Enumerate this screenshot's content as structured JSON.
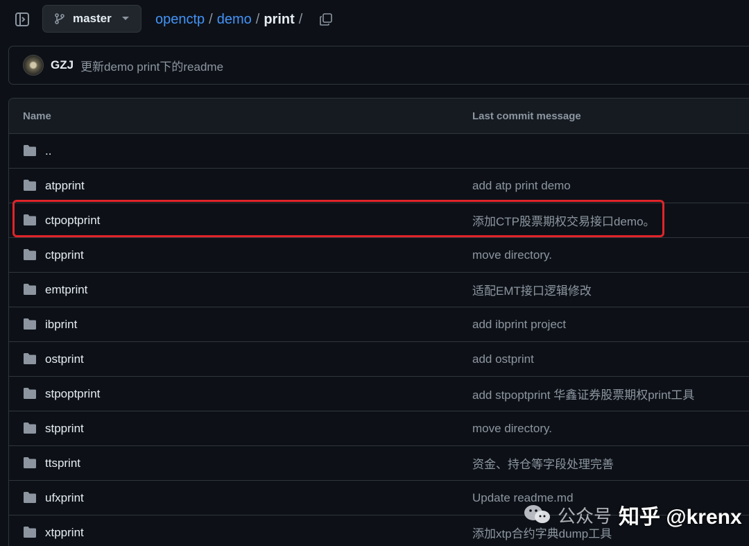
{
  "topbar": {
    "branch": "master",
    "breadcrumb": {
      "repo": "openctp",
      "sep1": "/",
      "dir1": "demo",
      "sep2": "/",
      "current": "print",
      "sep3": "/"
    }
  },
  "commit": {
    "author": "GZJ",
    "message": "更新demo print下的readme"
  },
  "table": {
    "headers": {
      "name": "Name",
      "message": "Last commit message"
    },
    "rows": [
      {
        "name": "..",
        "message": ""
      },
      {
        "name": "atpprint",
        "message": "add atp print demo"
      },
      {
        "name": "ctpoptprint",
        "message": "添加CTP股票期权交易接口demo。"
      },
      {
        "name": "ctpprint",
        "message": "move directory."
      },
      {
        "name": "emtprint",
        "message": "适配EMT接口逻辑修改"
      },
      {
        "name": "ibprint",
        "message": "add ibprint project"
      },
      {
        "name": "ostprint",
        "message": "add ostprint"
      },
      {
        "name": "stpoptprint",
        "message": "add stpoptprint 华鑫证券股票期权print工具"
      },
      {
        "name": "stpprint",
        "message": "move directory."
      },
      {
        "name": "ttsprint",
        "message": "资金、持仓等字段处理完善"
      },
      {
        "name": "ufxprint",
        "message": "Update readme.md"
      },
      {
        "name": "xtpprint",
        "message": "添加xtp合约字典dump工具"
      }
    ]
  },
  "watermark": {
    "small": "公众号",
    "big": "知乎 @krenx"
  },
  "colors": {
    "background": "#0d1117",
    "link": "#4493f8",
    "muted": "#8d96a0",
    "highlight": "#e0242a"
  }
}
